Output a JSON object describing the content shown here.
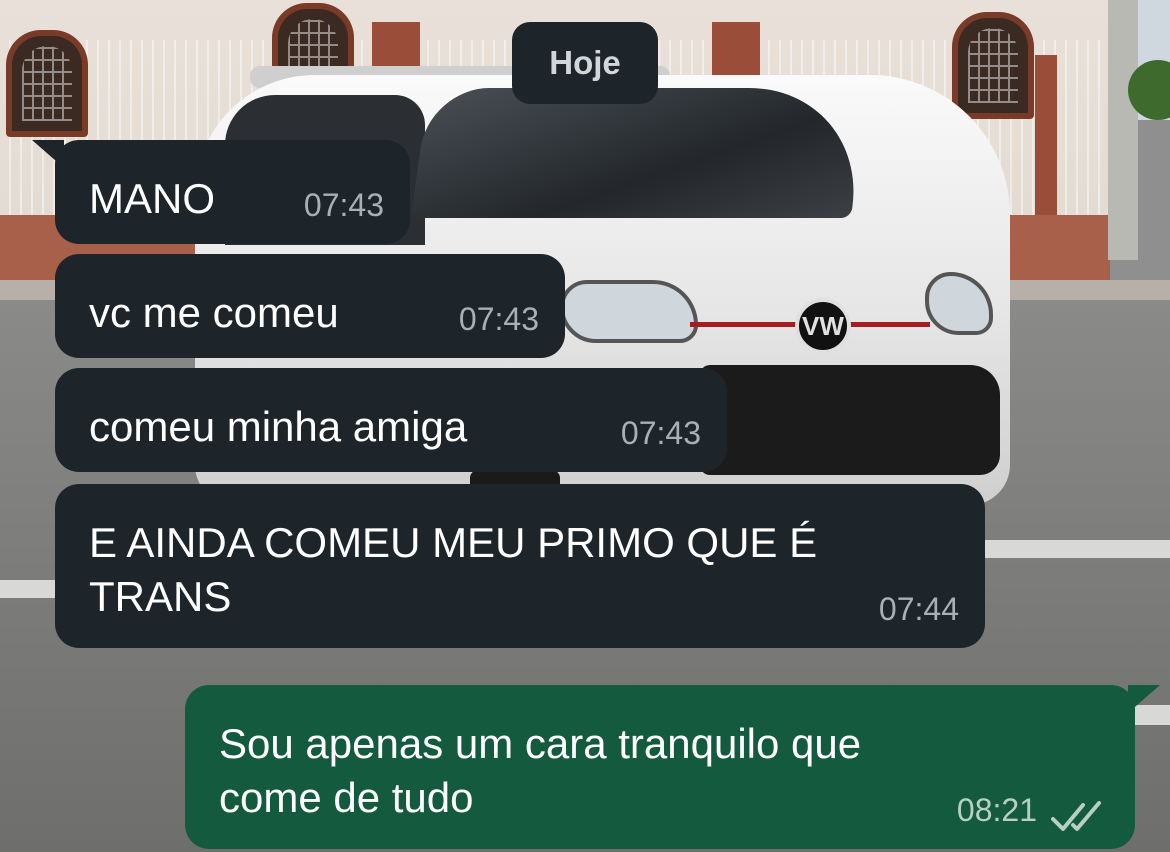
{
  "date_chip": "Hoje",
  "messages": [
    {
      "direction": "incoming",
      "text": "MANO",
      "time": "07:43"
    },
    {
      "direction": "incoming",
      "text": "vc me comeu",
      "time": "07:43"
    },
    {
      "direction": "incoming",
      "text": "comeu minha amiga",
      "time": "07:43"
    },
    {
      "direction": "incoming",
      "text": "E AINDA COMEU MEU PRIMO QUE É\nTRANS",
      "time": "07:44"
    },
    {
      "direction": "outgoing",
      "text": "Sou apenas um cara tranquilo que\ncome de tudo",
      "time": "08:21",
      "status": "read"
    }
  ],
  "background": {
    "logo_text": "VW"
  },
  "colors": {
    "incoming_bubble": "#1e252a",
    "outgoing_bubble": "#135a3e",
    "read_ticks": "#a9b0b5"
  },
  "icons": {
    "read_receipt": "double-check-icon"
  }
}
